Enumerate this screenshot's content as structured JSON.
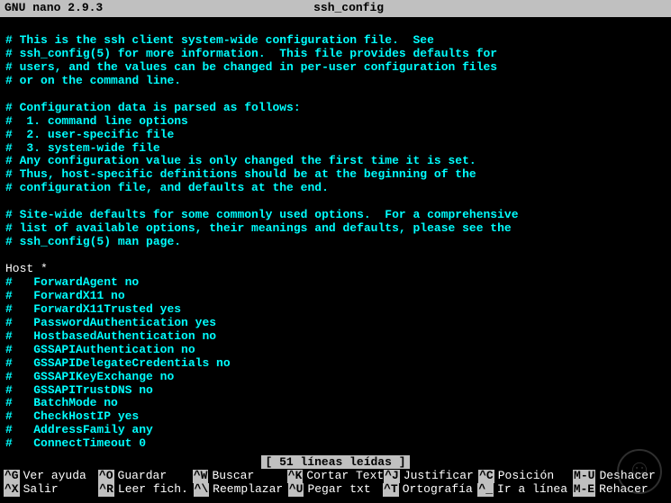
{
  "titlebar": {
    "app": "GNU nano 2.9.3",
    "filename": "ssh_config"
  },
  "lines": [
    {
      "type": "blank"
    },
    {
      "type": "comment",
      "text": " This is the ssh client system-wide configuration file.  See"
    },
    {
      "type": "comment",
      "text": " ssh_config(5) for more information.  This file provides defaults for"
    },
    {
      "type": "comment",
      "text": " users, and the values can be changed in per-user configuration files"
    },
    {
      "type": "comment",
      "text": " or on the command line."
    },
    {
      "type": "blank"
    },
    {
      "type": "comment",
      "text": " Configuration data is parsed as follows:"
    },
    {
      "type": "comment",
      "text": "  1. command line options"
    },
    {
      "type": "comment",
      "text": "  2. user-specific file"
    },
    {
      "type": "comment",
      "text": "  3. system-wide file"
    },
    {
      "type": "comment",
      "text": " Any configuration value is only changed the first time it is set."
    },
    {
      "type": "comment",
      "text": " Thus, host-specific definitions should be at the beginning of the"
    },
    {
      "type": "comment",
      "text": " configuration file, and defaults at the end."
    },
    {
      "type": "blank"
    },
    {
      "type": "comment",
      "text": " Site-wide defaults for some commonly used options.  For a comprehensive"
    },
    {
      "type": "comment",
      "text": " list of available options, their meanings and defaults, please see the"
    },
    {
      "type": "comment",
      "text": " ssh_config(5) man page."
    },
    {
      "type": "blank"
    },
    {
      "type": "plain",
      "text": "Host *"
    },
    {
      "type": "comment",
      "text": "   ForwardAgent no"
    },
    {
      "type": "comment",
      "text": "   ForwardX11 no"
    },
    {
      "type": "comment",
      "text": "   ForwardX11Trusted yes"
    },
    {
      "type": "comment",
      "text": "   PasswordAuthentication yes"
    },
    {
      "type": "comment",
      "text": "   HostbasedAuthentication no"
    },
    {
      "type": "comment",
      "text": "   GSSAPIAuthentication no"
    },
    {
      "type": "comment",
      "text": "   GSSAPIDelegateCredentials no"
    },
    {
      "type": "comment",
      "text": "   GSSAPIKeyExchange no"
    },
    {
      "type": "comment",
      "text": "   GSSAPITrustDNS no"
    },
    {
      "type": "comment",
      "text": "   BatchMode no"
    },
    {
      "type": "comment",
      "text": "   CheckHostIP yes"
    },
    {
      "type": "comment",
      "text": "   AddressFamily any"
    },
    {
      "type": "comment",
      "text": "   ConnectTimeout 0"
    }
  ],
  "status": "[ 51 líneas leídas ]",
  "shortcuts": {
    "row1": [
      {
        "key": "^G",
        "label": "Ver ayuda"
      },
      {
        "key": "^O",
        "label": "Guardar"
      },
      {
        "key": "^W",
        "label": "Buscar"
      },
      {
        "key": "^K",
        "label": "Cortar Text"
      },
      {
        "key": "^J",
        "label": "Justificar"
      },
      {
        "key": "^C",
        "label": "Posición"
      },
      {
        "key": "M-U",
        "label": "Deshacer"
      }
    ],
    "row2": [
      {
        "key": "^X",
        "label": "Salir"
      },
      {
        "key": "^R",
        "label": "Leer fich."
      },
      {
        "key": "^\\",
        "label": "Reemplazar"
      },
      {
        "key": "^U",
        "label": "Pegar txt"
      },
      {
        "key": "^T",
        "label": "Ortografía"
      },
      {
        "key": "^_",
        "label": "Ir a línea"
      },
      {
        "key": "M-E",
        "label": "Rehacer"
      }
    ]
  }
}
